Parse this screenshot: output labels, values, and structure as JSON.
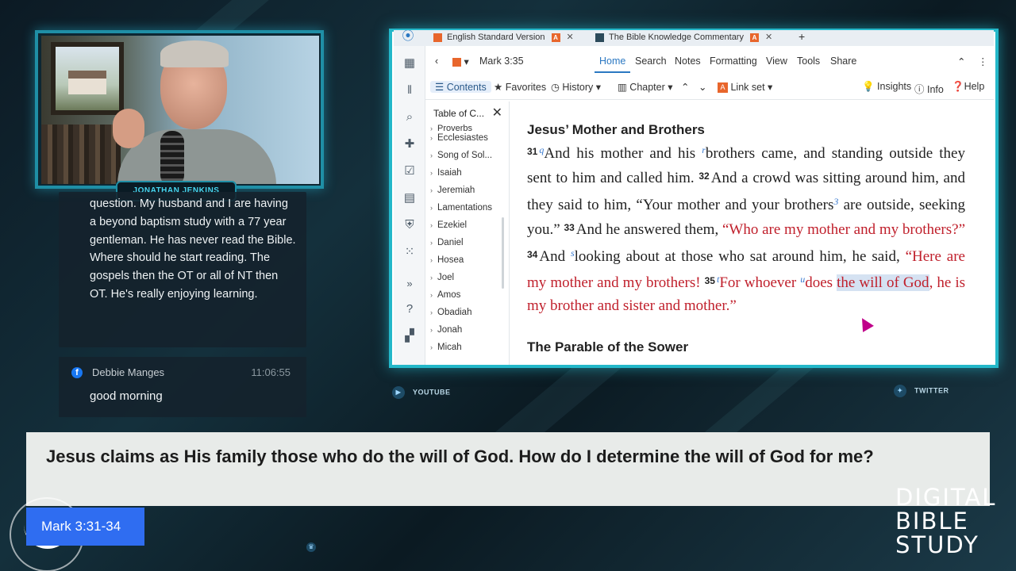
{
  "webcam": {
    "name_tag": "JONATHAN JENKINS"
  },
  "chat": {
    "message_1": "question. My husband and I are having a beyond baptism study with a 77 year gentleman. He has never read the Bible. Where should he start reading. The gospels then the OT or all of NT then OT. He's really enjoying learning.",
    "message_2": {
      "platform_icon": "facebook-icon",
      "author": "Debbie Manges",
      "time": "11:06:55",
      "text": "good morning"
    }
  },
  "app": {
    "tabs": [
      {
        "label": "English Standard Version"
      },
      {
        "label": "The Bible Knowledge Commentary"
      }
    ],
    "toolbar": {
      "reference": "Mark 3:35",
      "menu": [
        "Home",
        "Search",
        "Notes",
        "Formatting",
        "View",
        "Tools",
        "Share"
      ]
    },
    "toolbar2": {
      "contents": "Contents",
      "favorites": "Favorites",
      "history": "History",
      "chapter": "Chapter",
      "link_set": "Link set",
      "insights": "Insights",
      "info": "Info",
      "help": "Help"
    },
    "toc": {
      "title": "Table of C...",
      "items": [
        "Proverbs",
        "Ecclesiastes",
        "Song of Sol...",
        "Isaiah",
        "Jeremiah",
        "Lamentations",
        "Ezekiel",
        "Daniel",
        "Hosea",
        "Joel",
        "Amos",
        "Obadiah",
        "Jonah",
        "Micah"
      ]
    },
    "reader": {
      "heading_1": "Jesus’ Mother and Brothers",
      "v31_num": "31",
      "v31_fn1": "q",
      "v31_a": "And his mother and his ",
      "v31_fn2": "r",
      "v31_b": "brothers came, and standing outside they sent to him and called him. ",
      "v32_num": "32",
      "v32": "And a crowd was sitting around him, and they said to him, “Your mother and your brothers",
      "v32_fn": "3",
      "v32_b": " are outside, seeking you.” ",
      "v33_num": "33",
      "v33": "And he answered them, ",
      "v33_red": "“Who are my mother and my brothers?”",
      "v34_num": "34",
      "v34_a": "And ",
      "v34_fn": "s",
      "v34_b": "looking about at those who sat around him, he said, ",
      "v34_red": "“Here are my mother and my brothers! ",
      "v35_num": "35",
      "v35_fn1": "t",
      "v35_a": "For whoever ",
      "v35_fn2": "u",
      "v35_b": "does ",
      "v35_hl": "the will of God",
      "v35_c": ", he is my brother and sister and mother.”",
      "heading_2": "The Parable of the Sower"
    }
  },
  "social": {
    "youtube": "YOUTUBE",
    "twitter": "TWITTER"
  },
  "lower_third": {
    "question": "Jesus claims as His family those who do the will of God. How do I determine the will of God for me?",
    "reference": "Mark 3:31-34"
  },
  "brand": {
    "line1": "DIGITAL",
    "line2": "BIBLE",
    "line3": "STUDY"
  },
  "colors": {
    "accent_cyan": "#23b7c9",
    "ref_blue": "#2f6df1",
    "words_of_christ": "#c0202c"
  }
}
